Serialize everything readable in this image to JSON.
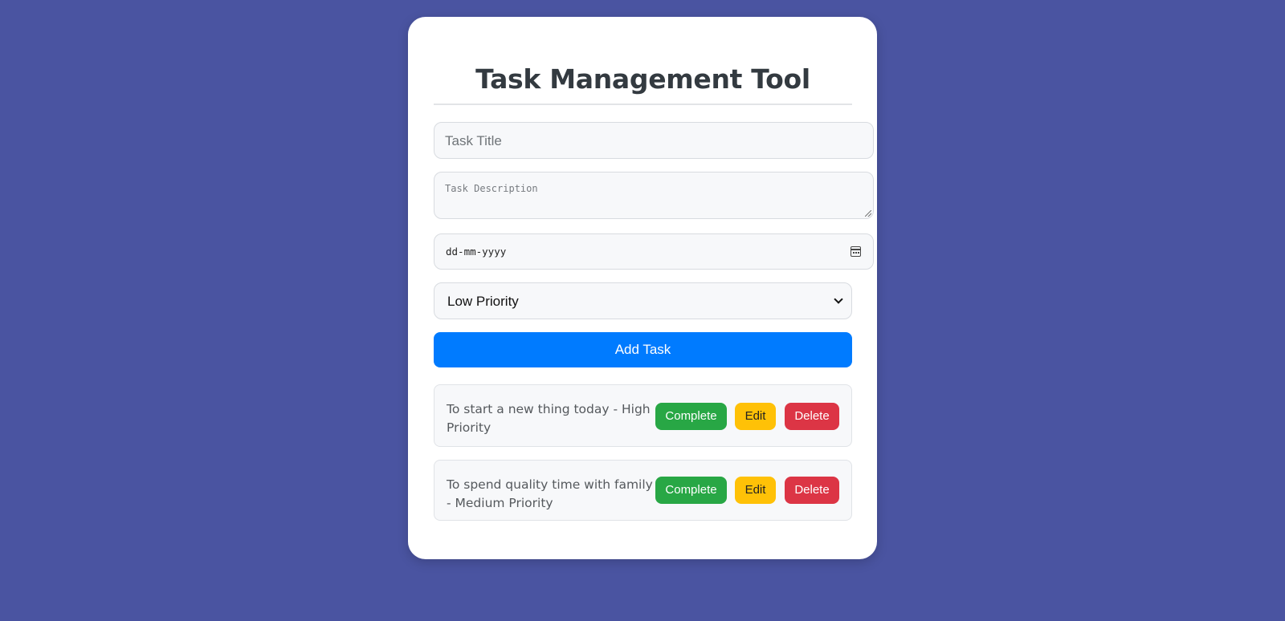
{
  "app": {
    "title": "Task Management Tool"
  },
  "form": {
    "task_title_placeholder": "Task Title",
    "task_description_placeholder": "Task Description",
    "due_date_placeholder": "dd-mm-yyyy",
    "priority": {
      "selected": "Low Priority"
    },
    "add_button_label": "Add Task"
  },
  "tasks": [
    {
      "text": "To start a new thing today - High Priority",
      "complete_label": "Complete",
      "edit_label": "Edit",
      "delete_label": "Delete"
    },
    {
      "text": "To spend quality time with family - Medium Priority",
      "complete_label": "Complete",
      "edit_label": "Edit",
      "delete_label": "Delete"
    }
  ],
  "colors": {
    "background": "#4a54a1",
    "primary": "#007bff",
    "success": "#28a745",
    "warning": "#ffc107",
    "danger": "#dc3545"
  },
  "icons": {
    "date_picker": "calendar-icon",
    "select_arrow": "chevron-down-icon"
  }
}
